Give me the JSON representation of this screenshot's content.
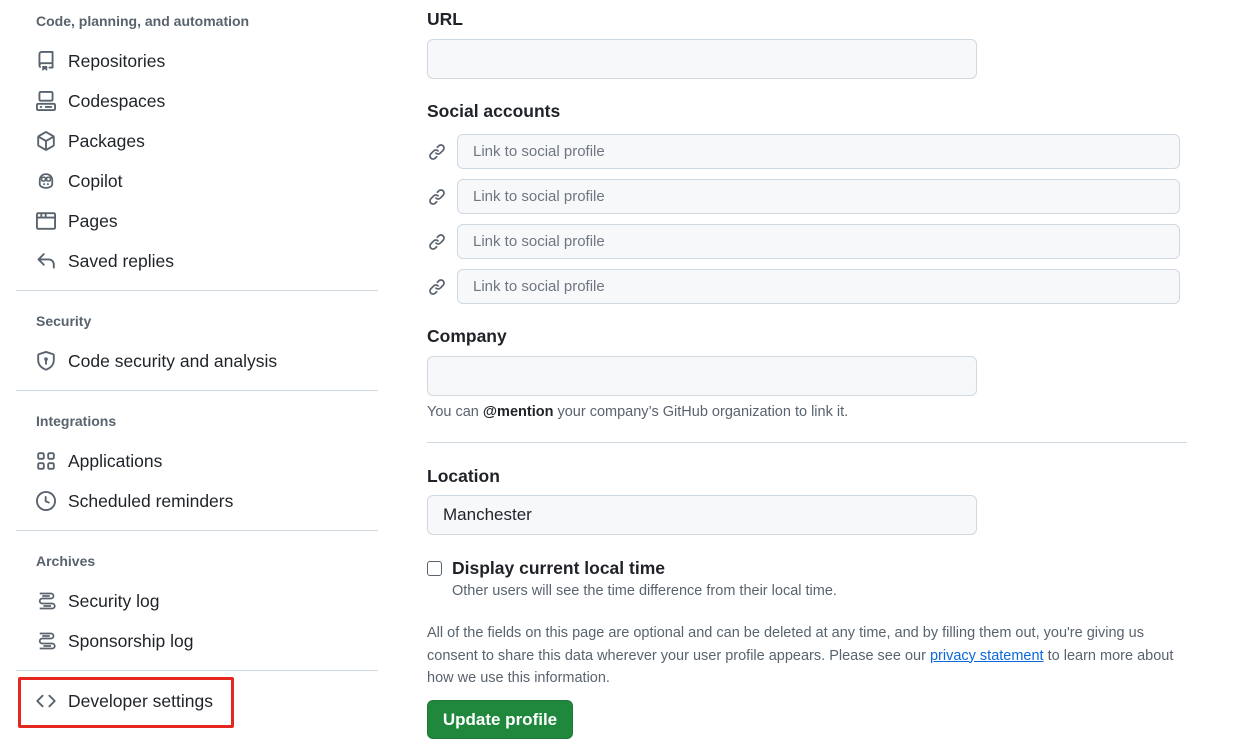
{
  "sidebar": {
    "groups": [
      {
        "heading": "Code, planning, and automation",
        "items": [
          {
            "label": "Repositories",
            "icon": "repo-icon"
          },
          {
            "label": "Codespaces",
            "icon": "codespaces-icon"
          },
          {
            "label": "Packages",
            "icon": "package-icon"
          },
          {
            "label": "Copilot",
            "icon": "copilot-icon"
          },
          {
            "label": "Pages",
            "icon": "browser-icon"
          },
          {
            "label": "Saved replies",
            "icon": "reply-icon"
          }
        ]
      },
      {
        "heading": "Security",
        "items": [
          {
            "label": "Code security and analysis",
            "icon": "shield-lock-icon"
          }
        ]
      },
      {
        "heading": "Integrations",
        "items": [
          {
            "label": "Applications",
            "icon": "apps-icon"
          },
          {
            "label": "Scheduled reminders",
            "icon": "clock-icon"
          }
        ]
      },
      {
        "heading": "Archives",
        "items": [
          {
            "label": "Security log",
            "icon": "log-icon"
          },
          {
            "label": "Sponsorship log",
            "icon": "log-icon"
          }
        ]
      }
    ],
    "developer_settings": {
      "label": "Developer settings",
      "icon": "code-icon"
    }
  },
  "form": {
    "url": {
      "label": "URL",
      "value": ""
    },
    "social": {
      "label": "Social accounts",
      "placeholder": "Link to social profile",
      "count": 4
    },
    "company": {
      "label": "Company",
      "value": "",
      "note_prefix": "You can ",
      "note_mention": "@mention",
      "note_suffix": " your company’s GitHub organization to link it."
    },
    "location": {
      "label": "Location",
      "value": "Manchester"
    },
    "local_time": {
      "label": "Display current local time",
      "checked": false,
      "note": "Other users will see the time difference from their local time."
    },
    "disclaimer": {
      "before": "All of the fields on this page are optional and can be deleted at any time, and by filling them out, you're giving us consent to share this data wherever your user profile appears. Please see our ",
      "link": "privacy statement",
      "after": " to learn more about how we use this information."
    },
    "submit_label": "Update profile"
  },
  "colors": {
    "primary_button": "#1f883d",
    "highlight": "#e5281f",
    "link": "#0969da"
  }
}
